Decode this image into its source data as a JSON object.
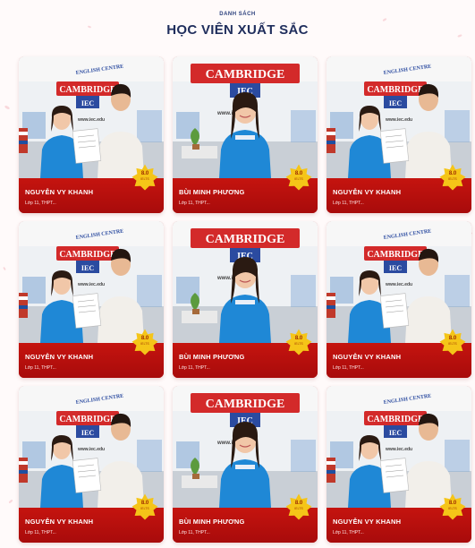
{
  "section": {
    "eyebrow": "DANH SÁCH",
    "title": "HỌC VIÊN XUẤT SẮC"
  },
  "photo_texts": {
    "centre": "ENGLISH CENTRE",
    "brand": "CAMBRIDGE",
    "logo": "IEC",
    "url": "www.iec.edu"
  },
  "students": [
    {
      "name": "NGUYỄN VY KHANH",
      "meta": "Lớp 11, THPT...",
      "score": "8.0",
      "score_label": "IELTS",
      "photo": "pair"
    },
    {
      "name": "BÙI MINH PHƯƠNG",
      "meta": "Lớp 11, THPT...",
      "score": "8.0",
      "score_label": "IELTS",
      "photo": "solo"
    },
    {
      "name": "NGUYỄN VY KHANH",
      "meta": "Lớp 11, THPT...",
      "score": "8.0",
      "score_label": "IELTS",
      "photo": "pair"
    },
    {
      "name": "NGUYỄN VY KHANH",
      "meta": "Lớp 11, THPT...",
      "score": "8.0",
      "score_label": "IELTS",
      "photo": "pair"
    },
    {
      "name": "BÙI MINH PHƯƠNG",
      "meta": "Lớp 11, THPT...",
      "score": "8.0",
      "score_label": "IELTS",
      "photo": "solo"
    },
    {
      "name": "NGUYỄN VY KHANH",
      "meta": "Lớp 11, THPT...",
      "score": "8.0",
      "score_label": "IELTS",
      "photo": "pair"
    },
    {
      "name": "NGUYỄN VY KHANH",
      "meta": "Lớp 11, THPT...",
      "score": "8.0",
      "score_label": "IELTS",
      "photo": "pair"
    },
    {
      "name": "BÙI MINH PHƯƠNG",
      "meta": "Lớp 11, THPT...",
      "score": "8.0",
      "score_label": "IELTS",
      "photo": "solo"
    },
    {
      "name": "NGUYỄN VY KHANH",
      "meta": "Lớp 11, THPT...",
      "score": "8.0",
      "score_label": "IELTS",
      "photo": "pair"
    }
  ],
  "colors": {
    "card_red": "#b81010",
    "title_navy": "#1f2d5c",
    "badge_gold": "#f5c518",
    "brand_red": "#d32a2a",
    "shirt_blue": "#1f88d6"
  }
}
